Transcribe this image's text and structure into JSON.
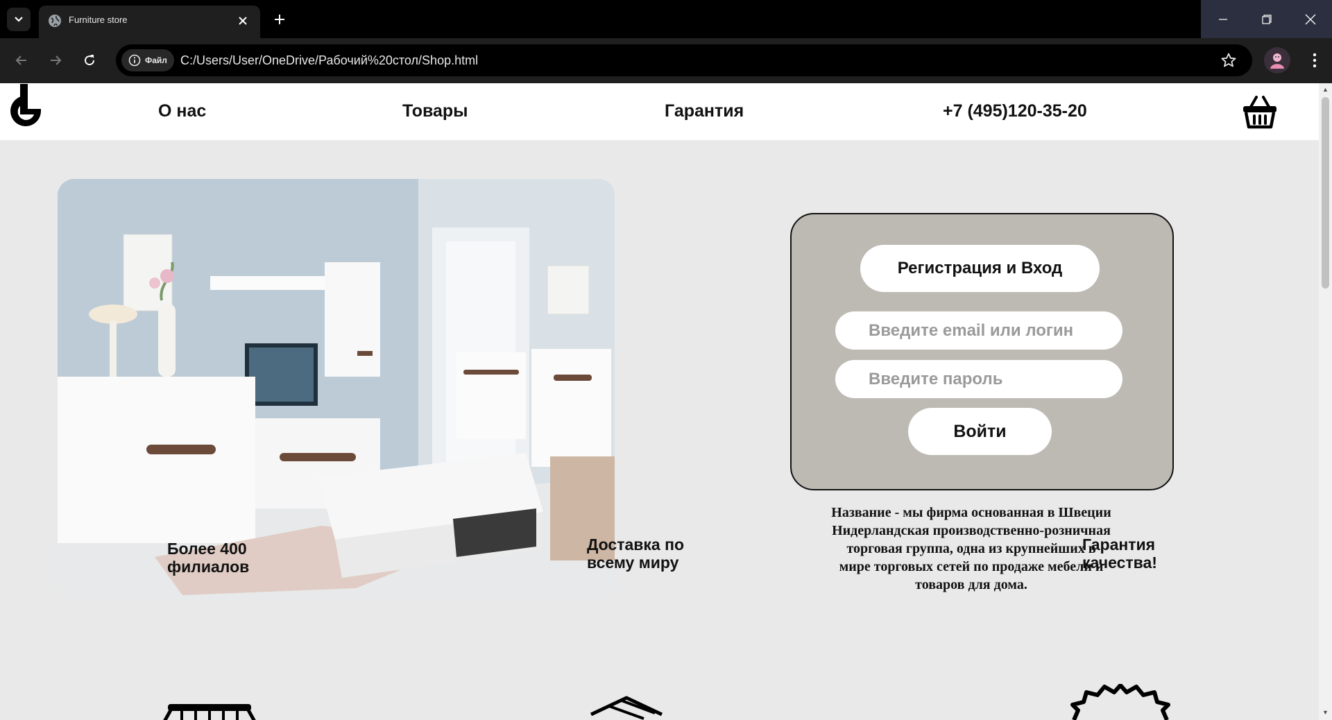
{
  "browser": {
    "tab_title": "Furniture store",
    "chip_label": "Файл",
    "url": "C:/Users/User/OneDrive/Рабочий%20стол/Shop.html"
  },
  "header": {
    "nav": [
      "О нас",
      "Товары",
      "Гарантия"
    ],
    "phone": "+7 (495)120-35-20"
  },
  "login": {
    "register_label": "Регистрация и Вход",
    "email_placeholder": "Введите email или логин",
    "password_placeholder": "Введите пароль",
    "login_label": "Войти"
  },
  "about": {
    "line1": "Название - мы фирма основанная в Швеции",
    "line2": "Нидерландская производственно-розничная",
    "line3": "торговая группа, одна из крупнейших в",
    "line4": "мире торговых сетей по продаже мебели и",
    "line5": "товаров для дома."
  },
  "features": [
    {
      "line1": "Более 400",
      "line2": "филиалов",
      "icon": "store-icon"
    },
    {
      "line1": "Доставка по",
      "line2": "всему миру",
      "icon": "box-icon"
    },
    {
      "line1": "Гарантия",
      "line2": "качества!",
      "icon": "badge-icon"
    }
  ]
}
